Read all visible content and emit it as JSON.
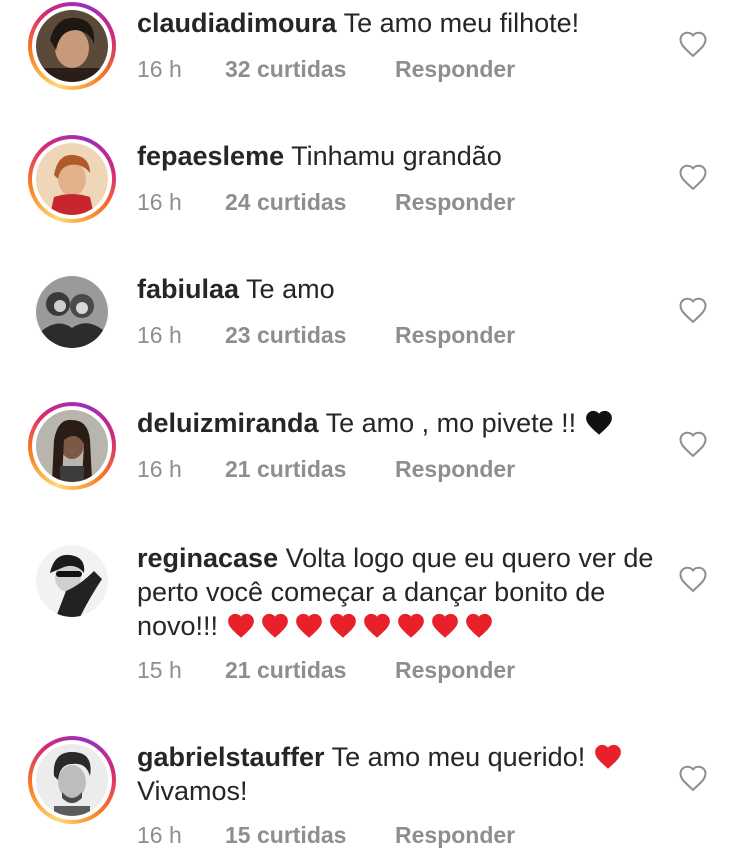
{
  "colors": {
    "text": "#262626",
    "meta": "#8e8e8e",
    "red_heart": "#e8202a",
    "black_heart": "#111111"
  },
  "comments": [
    {
      "username": "claudiadimoura",
      "text": "Te amo meu filhote!",
      "emojis": [],
      "time": "16 h",
      "likes": "32 curtidas",
      "reply": "Responder",
      "story_ring": true
    },
    {
      "username": "fepaesleme",
      "text": "Tinhamu grandão",
      "emojis": [],
      "time": "16 h",
      "likes": "24 curtidas",
      "reply": "Responder",
      "story_ring": true
    },
    {
      "username": "fabiulaa",
      "text": "Te amo",
      "emojis": [],
      "time": "16 h",
      "likes": "23 curtidas",
      "reply": "Responder",
      "story_ring": false
    },
    {
      "username": "deluizmiranda",
      "text": "Te amo , mo pivete !!",
      "emojis": [
        "black-heart"
      ],
      "time": "16 h",
      "likes": "21 curtidas",
      "reply": "Responder",
      "story_ring": true
    },
    {
      "username": "reginacase",
      "text": "Volta logo que eu quero ver de perto você começar a dançar bonito de novo!!!",
      "emojis": [
        "red-heart",
        "red-heart",
        "red-heart",
        "red-heart",
        "red-heart",
        "red-heart",
        "red-heart",
        "red-heart"
      ],
      "time": "15 h",
      "likes": "21 curtidas",
      "reply": "Responder",
      "story_ring": false
    },
    {
      "username": "gabrielstauffer",
      "text": "Te amo meu querido!",
      "text_after": "Vivamos!",
      "emojis": [
        "red-heart"
      ],
      "time": "16 h",
      "likes": "15 curtidas",
      "reply": "Responder",
      "story_ring": true
    }
  ]
}
